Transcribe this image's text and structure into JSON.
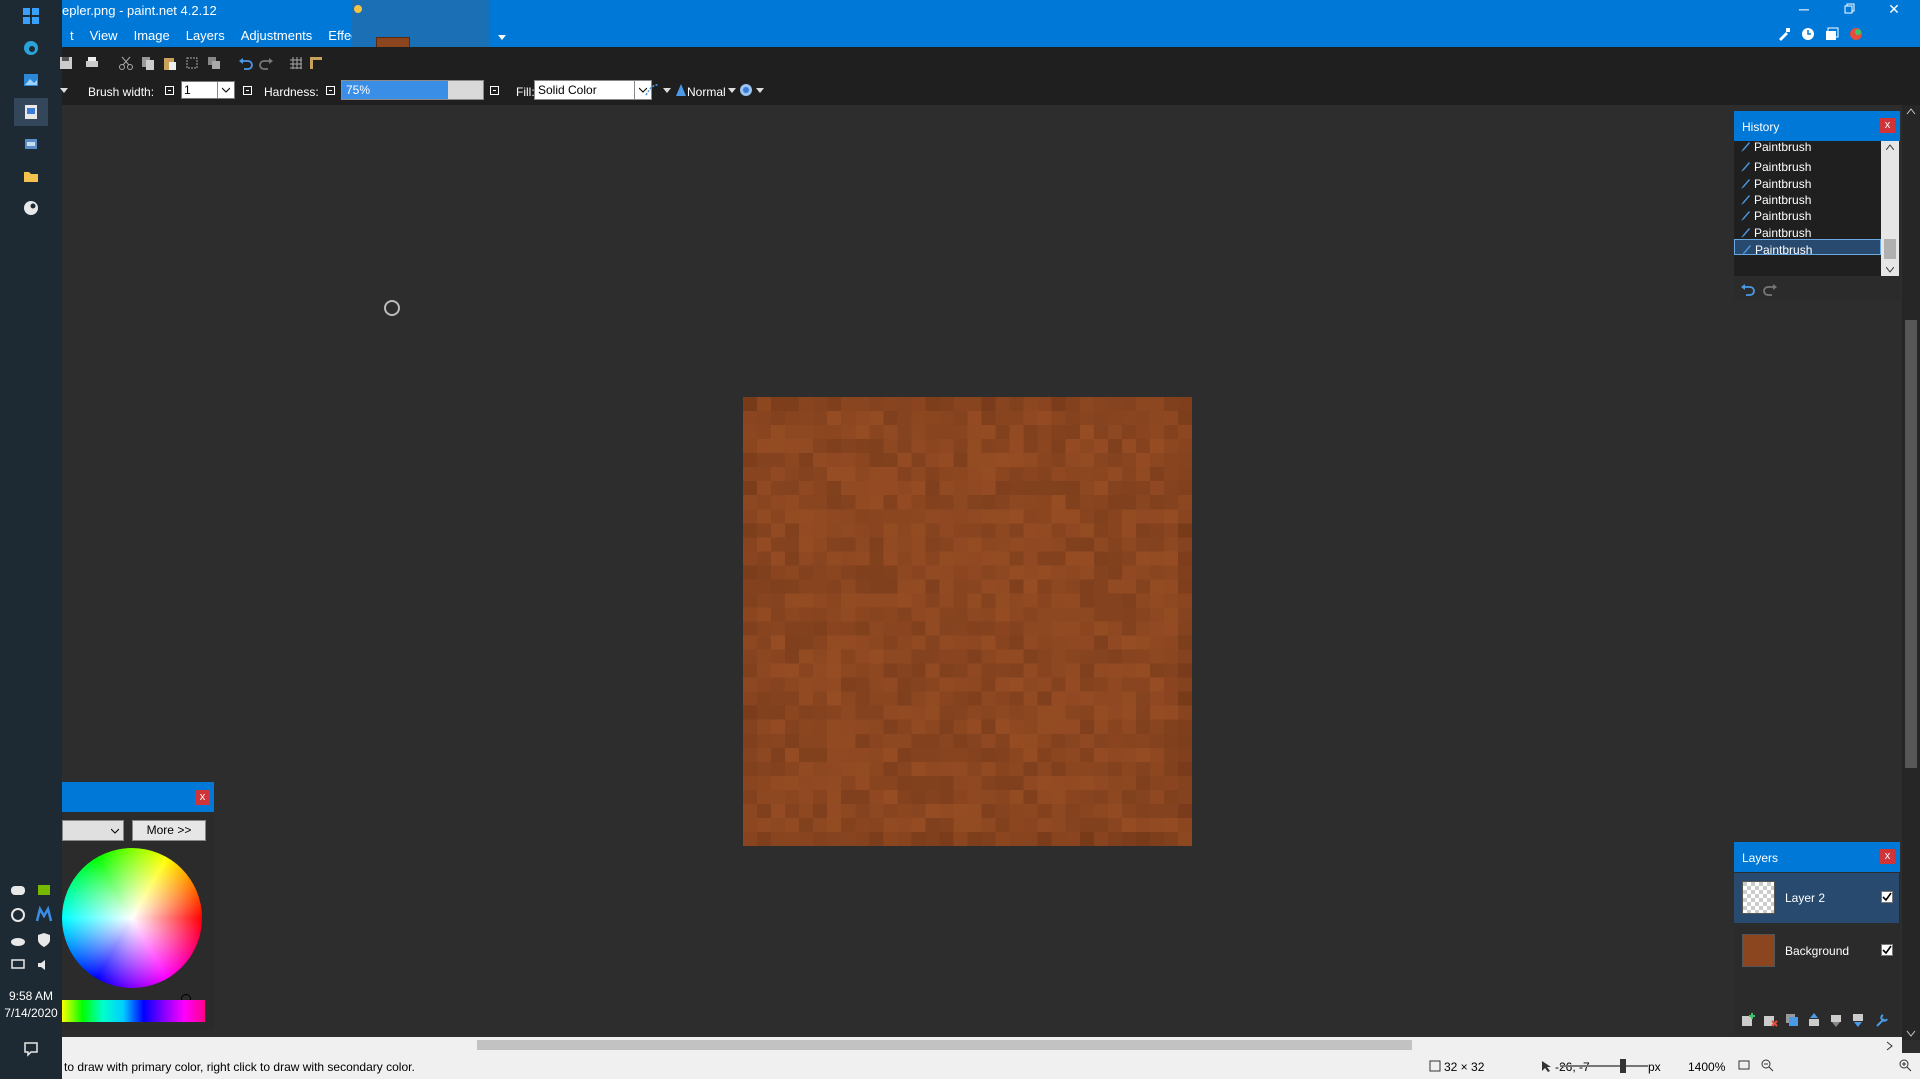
{
  "window": {
    "title": "epler.png - paint.net 4.2.12",
    "minimize_glyph": "─",
    "close_glyph": "✕"
  },
  "menu": {
    "items": [
      "t",
      "View",
      "Image",
      "Layers",
      "Adjustments",
      "Effects"
    ]
  },
  "toolbar": {
    "brush_width_label": "Brush width:",
    "brush_width_value": "1",
    "hardness_label": "Hardness:",
    "hardness_value": "75%",
    "hardness_fraction": 0.75,
    "fill_label": "Fill:",
    "fill_value": "Solid Color",
    "blend_mode": "Normal"
  },
  "history": {
    "title": "History",
    "items": [
      "Paintbrush",
      "Paintbrush",
      "Paintbrush",
      "Paintbrush",
      "Paintbrush",
      "Paintbrush",
      "Paintbrush"
    ],
    "selected_index": 6
  },
  "layers": {
    "title": "Layers",
    "items": [
      {
        "name": "Layer 2",
        "visible": true,
        "selected": true
      },
      {
        "name": "Background",
        "visible": true,
        "selected": false
      }
    ]
  },
  "colors": {
    "more_label": "More >>",
    "close_label": "x"
  },
  "taskbar": {
    "time": "9:58 AM",
    "date": "7/14/2020"
  },
  "status": {
    "hint": "to draw with primary color, right click to draw with secondary color.",
    "image_size": "32 × 32",
    "cursor_pos": "-26, -7",
    "unit": "px",
    "zoom": "1400%"
  },
  "colors_theme": {
    "accent": "#0078d7",
    "canvas_bg": "#2d2d2d",
    "image_base": "#8b4620"
  }
}
